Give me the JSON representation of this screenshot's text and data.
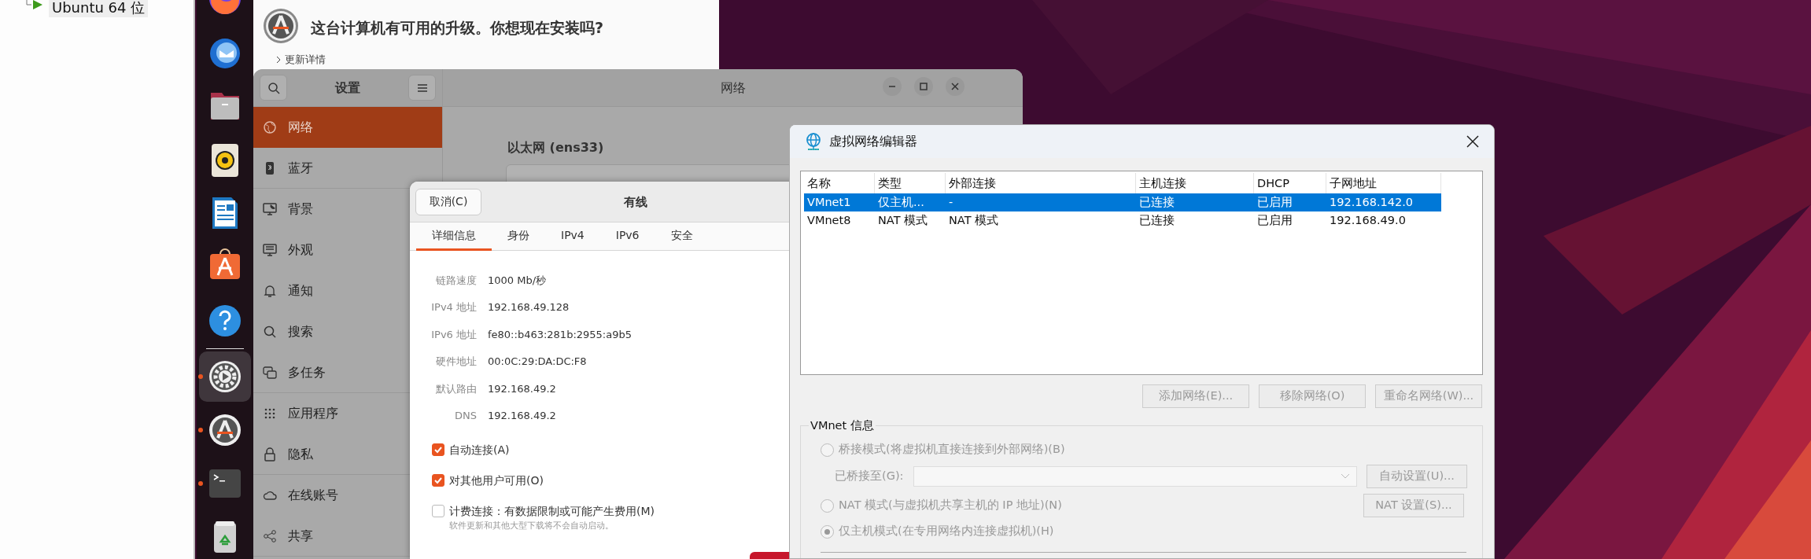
{
  "vm_library": {
    "items": [
      {
        "label": "Ubuntu 64 位",
        "selected": true
      }
    ]
  },
  "dock": {
    "apps": [
      {
        "kind": "browser",
        "running": false,
        "focused": false
      },
      {
        "kind": "mail",
        "running": false,
        "focused": false
      },
      {
        "kind": "files",
        "running": false,
        "focused": false
      },
      {
        "kind": "music",
        "running": false,
        "focused": false
      },
      {
        "kind": "writer",
        "running": false,
        "focused": false
      },
      {
        "kind": "store",
        "running": false,
        "focused": false
      },
      {
        "kind": "help",
        "running": false,
        "focused": false
      },
      {
        "kind": "settings",
        "running": true,
        "focused": true
      },
      {
        "kind": "updater",
        "running": true,
        "focused": false
      },
      {
        "kind": "terminal",
        "running": true,
        "focused": false
      },
      {
        "kind": "trash",
        "running": false,
        "focused": false
      }
    ]
  },
  "updater": {
    "message": "这台计算机有可用的升级。你想现在安装吗?",
    "details_toggle": "更新详情"
  },
  "settings": {
    "title": "设置",
    "page_title": "网络",
    "section_title": "以太网 (ens33)",
    "sidebar": [
      {
        "kind": "network",
        "label": "网络",
        "selected": true,
        "divider_after": false
      },
      {
        "kind": "bluetooth",
        "label": "蓝牙",
        "selected": false,
        "divider_after": true
      },
      {
        "kind": "background",
        "label": "背景",
        "selected": false,
        "divider_after": false
      },
      {
        "kind": "appearance",
        "label": "外观",
        "selected": false,
        "divider_after": false
      },
      {
        "kind": "notifications",
        "label": "通知",
        "selected": false,
        "divider_after": false
      },
      {
        "kind": "search",
        "label": "搜索",
        "selected": false,
        "divider_after": false
      },
      {
        "kind": "multitasking",
        "label": "多任务",
        "selected": false,
        "divider_after": true
      },
      {
        "kind": "apps",
        "label": "应用程序",
        "selected": false,
        "divider_after": false
      },
      {
        "kind": "privacy",
        "label": "隐私",
        "selected": false,
        "divider_after": true
      },
      {
        "kind": "accounts",
        "label": "在线账号",
        "selected": false,
        "divider_after": false
      },
      {
        "kind": "sharing",
        "label": "共享",
        "selected": false,
        "divider_after": true
      }
    ]
  },
  "wired_dialog": {
    "cancel": "取消(C)",
    "title": "有线",
    "tabs": [
      {
        "label": "详细信息",
        "selected": true
      },
      {
        "label": "身份",
        "selected": false
      },
      {
        "label": "IPv4",
        "selected": false
      },
      {
        "label": "IPv6",
        "selected": false
      },
      {
        "label": "安全",
        "selected": false
      }
    ],
    "details": [
      {
        "label": "链路速度",
        "value": "1000 Mb/秒"
      },
      {
        "label": "IPv4 地址",
        "value": "192.168.49.128"
      },
      {
        "label": "IPv6 地址",
        "value": "fe80::b463:281b:2955:a9b5"
      },
      {
        "label": "硬件地址",
        "value": "00:0C:29:DA:DC:F8"
      },
      {
        "label": "默认路由",
        "value": "192.168.49.2"
      },
      {
        "label": "DNS",
        "value": "192.168.49.2"
      }
    ],
    "options": [
      {
        "label": "自动连接(A)",
        "checked": true
      },
      {
        "label": "对其他用户可用(O)",
        "checked": true
      },
      {
        "label": "计费连接：有数据限制或可能产生费用(M)",
        "checked": false,
        "hint": "软件更新和其他大型下载将不会自动启动。"
      }
    ]
  },
  "vnet_editor": {
    "title": "虚拟网络编辑器",
    "table": {
      "columns": [
        "名称",
        "类型",
        "外部连接",
        "主机连接",
        "DHCP",
        "子网地址"
      ],
      "rows": [
        {
          "cells": [
            "VMnet1",
            "仅主机...",
            "-",
            "已连接",
            "已启用",
            "192.168.142.0"
          ],
          "selected": true
        },
        {
          "cells": [
            "VMnet8",
            "NAT 模式",
            "NAT 模式",
            "已连接",
            "已启用",
            "192.168.49.0"
          ],
          "selected": false
        }
      ]
    },
    "buttons": [
      {
        "label": "添加网络(E)...",
        "disabled": true
      },
      {
        "label": "移除网络(O)",
        "disabled": true
      },
      {
        "label": "重命名网络(W)...",
        "disabled": true
      }
    ],
    "group_title": "VMnet 信息",
    "modes": [
      {
        "label": "桥接模式(将虚拟机直接连接到外部网络)(B)",
        "selected": false,
        "disabled": true
      },
      {
        "label": "NAT 模式(与虚拟机共享主机的 IP 地址)(N)",
        "selected": false,
        "disabled": true
      },
      {
        "label": "仅主机模式(在专用网络内连接虚拟机)(H)",
        "selected": true,
        "disabled": true
      }
    ],
    "bridged_to_label": "已桥接至(G):",
    "auto_settings": {
      "label": "自动设置(U)...",
      "disabled": true
    },
    "nat_settings": {
      "label": "NAT 设置(S)...",
      "disabled": true
    }
  }
}
